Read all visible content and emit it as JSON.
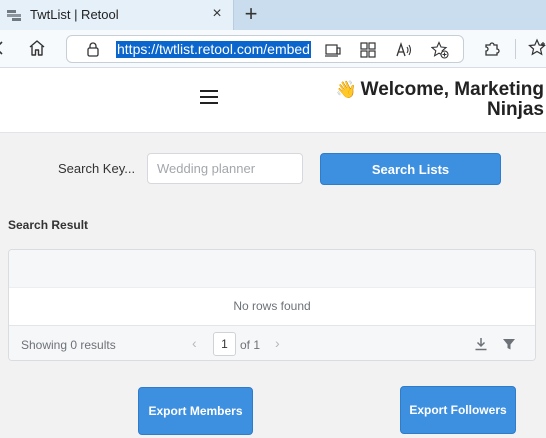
{
  "browser": {
    "tab_title": "TwtList | Retool",
    "close_glyph": "×",
    "new_tab_glyph": "+",
    "url": "https://twtlist.retool.com/embed",
    "icons": [
      "back-icon",
      "home-icon",
      "lock-icon",
      "reader-view-icon",
      "apps-icon",
      "read-aloud-icon",
      "favorite-add-icon",
      "extensions-icon",
      "favorites-icon"
    ]
  },
  "header": {
    "welcome_emoji": "👋",
    "welcome_text": "Welcome, Marketing Ninjas"
  },
  "search": {
    "label": "Search Key...",
    "placeholder": "Wedding planner",
    "value": "",
    "button_label": "Search Lists"
  },
  "results": {
    "title": "Search Result",
    "empty_message": "No rows found",
    "showing": "Showing 0 results",
    "current_page": "1",
    "of_pages": "of 1",
    "prev_glyph": "‹",
    "next_glyph": "›"
  },
  "actions": {
    "export_members": "Export Members",
    "export_followers": "Export Followers"
  },
  "colors": {
    "primary": "#3d8fe0",
    "url_highlight": "#0a65cc",
    "tab_active": "#e6f0f9"
  }
}
